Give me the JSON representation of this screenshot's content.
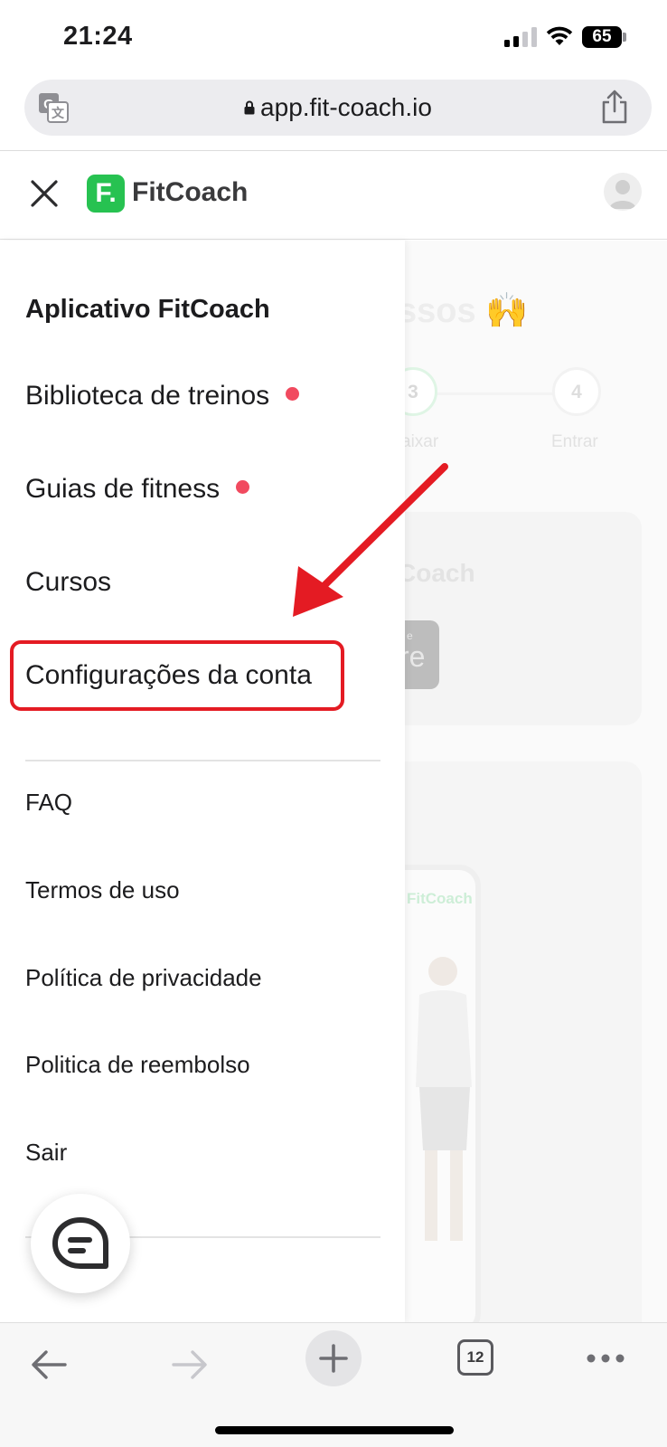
{
  "status_bar": {
    "time": "21:24",
    "battery_level": "65",
    "signal_bars_on": 2,
    "signal_bars_total": 4
  },
  "browser": {
    "url": "app.fit-coach.io",
    "tabs_count": "12"
  },
  "header": {
    "logo_mark": "F.",
    "app_name": "FitCoach",
    "brand_color": "#27c251"
  },
  "background_page": {
    "title_fragment": "ssos 🙌",
    "step_3": "3",
    "step_4": "4",
    "step_3_label": "aixar",
    "step_4_label": "Entrar",
    "card_text": "Coach",
    "store_small": "e",
    "store_large": "re",
    "phone_logo": "FitCoach"
  },
  "menu": {
    "heading": "Aplicativo FitCoach",
    "main_items": [
      {
        "label": "Biblioteca de treinos",
        "has_dot": true
      },
      {
        "label": "Guias de fitness",
        "has_dot": true
      },
      {
        "label": "Cursos",
        "has_dot": false
      },
      {
        "label": "Configurações da conta",
        "has_dot": false
      }
    ],
    "secondary_items": [
      {
        "label": "FAQ"
      },
      {
        "label": "Termos de uso"
      },
      {
        "label": "Política de privacidade"
      },
      {
        "label": "Politica de reembolso"
      },
      {
        "label": "Sair"
      }
    ],
    "notification_dot_color": "#f14a5f",
    "annotation_color": "#e41b23"
  }
}
